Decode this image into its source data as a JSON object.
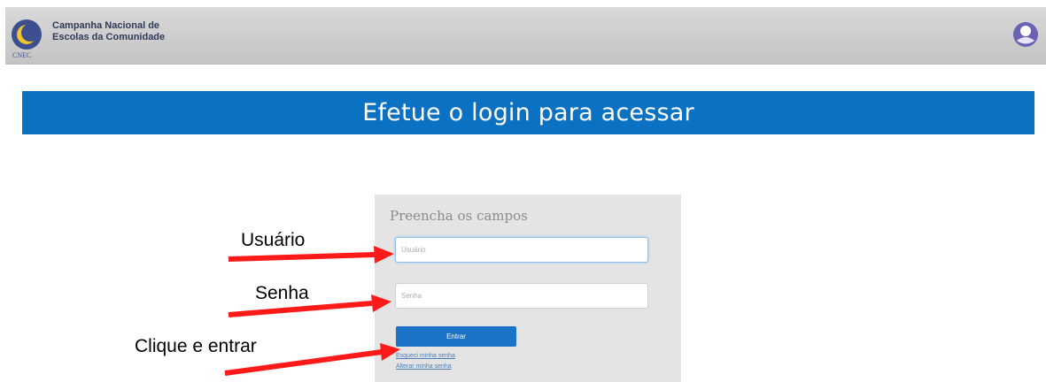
{
  "header": {
    "org_name_line1": "Campanha Nacional de",
    "org_name_line2": "Escolas da Comunidade",
    "logo_caption": "CNEC",
    "logo_icon": "cnec-logo",
    "right_icon": "portal-icon"
  },
  "banner": {
    "text": "Efetue o login para acessar",
    "color": "#0b72c3"
  },
  "login": {
    "title": "Preencha os campos",
    "username_placeholder": "Usuário",
    "password_placeholder": "Senha",
    "submit_label": "Entrar",
    "forgot_link": "Esqueci minha senha",
    "change_link": "Alterar minha senha",
    "button_color": "#1a73c7"
  },
  "annotations": {
    "username": "Usuário",
    "password": "Senha",
    "submit": "Clique e entrar",
    "arrow_color": "#ff1a1a"
  }
}
